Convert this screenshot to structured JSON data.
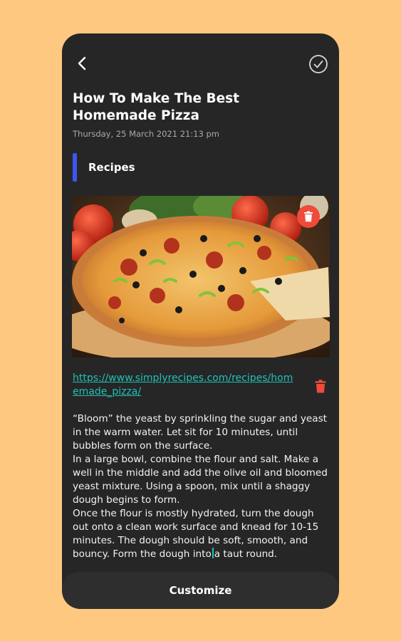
{
  "header": {
    "back_icon": "chevron-left-icon",
    "save_icon": "check-circle-icon"
  },
  "note": {
    "title": "How To Make The Best Homemade Pizza",
    "date": "Thursday, 25 March 2021 21:13 pm",
    "category": {
      "label": "Recipes",
      "color": "#3D56F0"
    },
    "image": {
      "description": "pizza-photo",
      "delete_icon": "trash-icon"
    },
    "link": {
      "text": "https://www.simplyrecipes.com/recipes/homemade_pizza/",
      "color": "#1FC2B6",
      "delete_icon": "trash-icon"
    },
    "body_before_caret": "“Bloom” the yeast by sprinkling the sugar and yeast in the warm water. Let sit for 10 minutes, until bubbles form on the surface.\nIn a large bowl, combine the flour and salt. Make a well in the middle and add the olive oil and bloomed yeast mixture. Using a spoon, mix until a shaggy dough begins to form.\nOnce the flour is mostly hydrated, turn the dough out onto a clean work surface and knead for 10-15 minutes. The dough should be soft, smooth, and bouncy. Form the dough into",
    "body_after_caret": "a taut round."
  },
  "bottom_bar": {
    "label": "Customize"
  },
  "colors": {
    "background": "#FFC880",
    "panel": "#262626",
    "delete_red": "#EF4A3A"
  }
}
